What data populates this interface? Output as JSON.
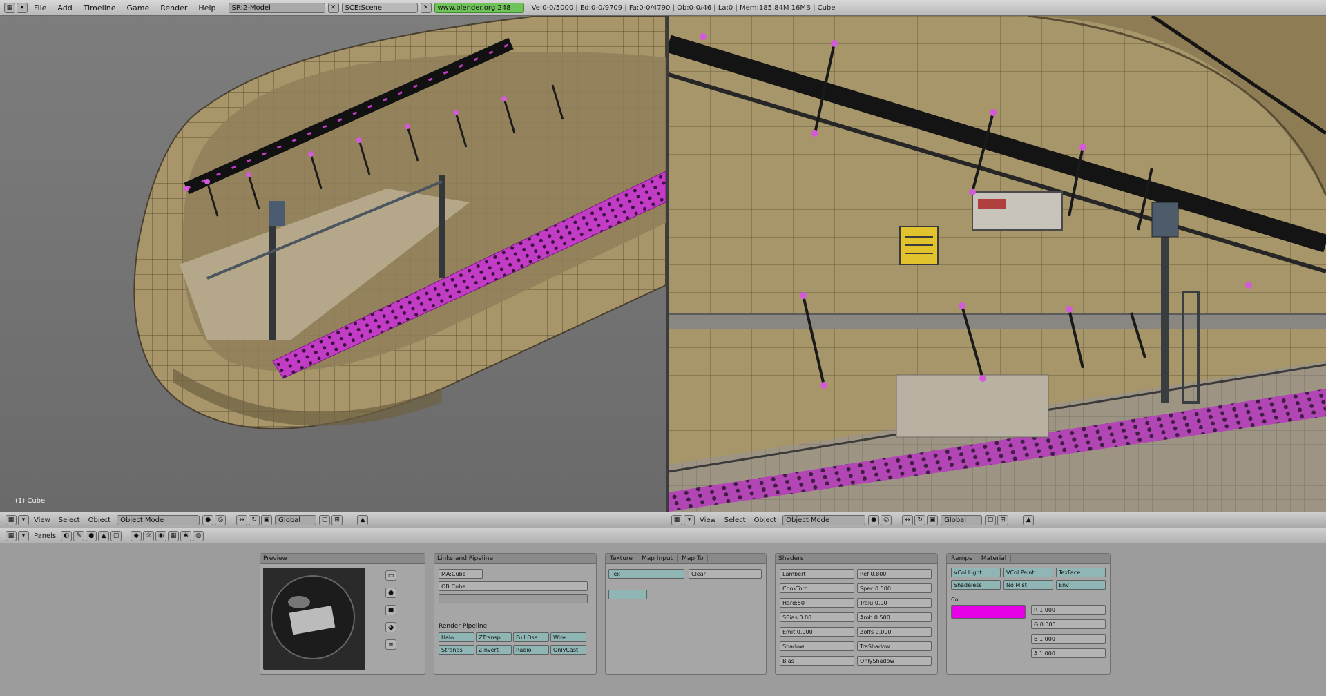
{
  "topbar": {
    "menus": [
      "File",
      "Add",
      "Timeline",
      "Game",
      "Render",
      "Help"
    ],
    "screen_label": "SR:2-Model",
    "scene_label": "SCE:Scene",
    "file_label": "www.blender.org 248",
    "info": "Ve:0-0/5000 | Ed:0-0/9709 | Fa:0-0/4790 | Ob:0-0/46 | La:0 | Mem:185.84M 16MB | Cube"
  },
  "left_viewport": {
    "header_menus": [
      "View",
      "Select",
      "Object"
    ],
    "mode": "Object Mode",
    "pivot": "Global",
    "corner_label": "(1) Cube"
  },
  "right_viewport": {
    "header_menus": [
      "View",
      "Select",
      "Object"
    ],
    "mode": "Object Mode",
    "pivot": "Global"
  },
  "buttons_window": {
    "header_label": "Panels",
    "preview_panel": {
      "title": "Preview"
    },
    "material_panel": {
      "title": "Links and Pipeline",
      "link": "MA:Cube",
      "object": "OB:Cube",
      "render_pipeline": "Render Pipeline",
      "buttons": [
        "Halo",
        "ZTransp",
        "Full Osa",
        "Wire",
        "Strands",
        "ZInvert",
        "Radio",
        "OnlyCast"
      ]
    },
    "texture_panel": {
      "title": "Texture",
      "tabs": [
        "Map Input",
        "Map To"
      ],
      "channel": "Tex",
      "clear": "Clear"
    },
    "shaders_panel": {
      "title": "Shaders",
      "fields": [
        "Lambert",
        "Ref 0.800",
        "CookTorr",
        "Spec 0.500",
        "Hard:50",
        "Tralu 0.00",
        "SBias 0.00",
        "Amb 0.500",
        "Emit 0.000",
        "Zoffs 0.000",
        "Shadow",
        "TraShadow",
        "Bias",
        "OnlyShadow"
      ]
    },
    "material_colors_panel": {
      "title": "Material",
      "tabs": [
        "Ramps",
        "Material"
      ],
      "color_label": "Col",
      "fields": [
        "VCol Light",
        "VCol Paint",
        "TexFace",
        "Shadeless",
        "No Mist",
        "Env",
        "R 1.000",
        "G 0.000",
        "B 1.000",
        "A 1.000"
      ],
      "color": "#e600e6"
    },
    "accent_colors": {
      "selection": "#e600e6",
      "green_field": "#6fc35a",
      "panel": "#a6a6a6"
    }
  }
}
